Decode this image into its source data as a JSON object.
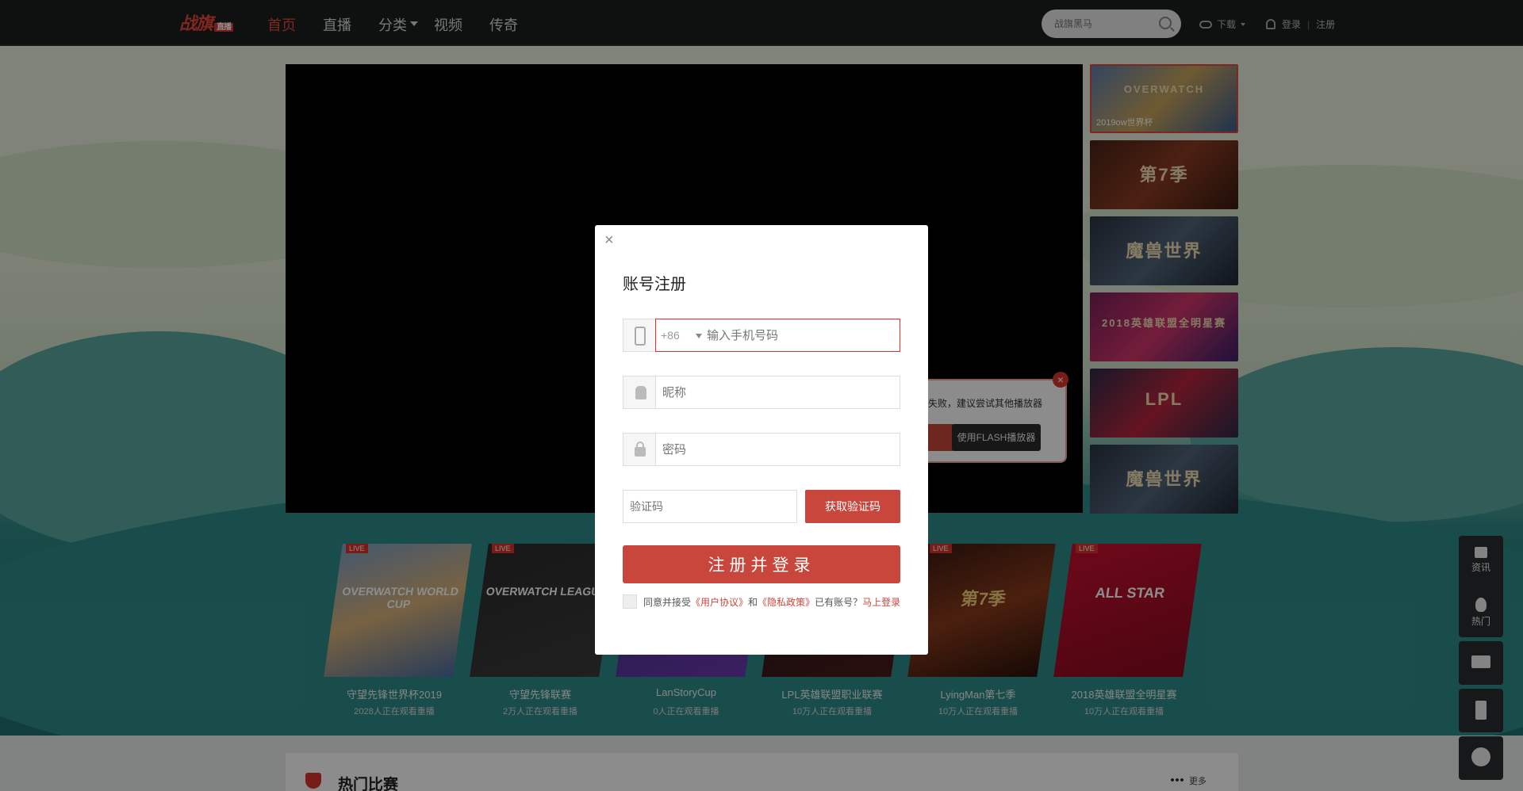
{
  "brand": {
    "logo_text": "战旗",
    "logo_sub": "直播"
  },
  "nav": {
    "items": [
      "首页",
      "直播",
      "分类",
      "视频",
      "传奇"
    ]
  },
  "search": {
    "placeholder": "战旗黑马"
  },
  "header": {
    "download": "下载",
    "login": "登录",
    "sep": "|",
    "register": "注册"
  },
  "flash": {
    "tip": "失败，建议尝试其他播放器",
    "use_flash": "使用FLASH播放器",
    "close": "×"
  },
  "thumbs": [
    {
      "caption": "2019ow世界杯",
      "text": "OVERWATCH"
    },
    {
      "caption": "",
      "text": "第7季"
    },
    {
      "caption": "",
      "text": "魔兽世界"
    },
    {
      "caption": "",
      "text": "2018英雄联盟全明星赛"
    },
    {
      "caption": "",
      "text": "LPL"
    },
    {
      "caption": "",
      "text": "魔兽世界"
    }
  ],
  "lives": [
    {
      "tag": "LIVE",
      "name": "守望先锋世界杯2019",
      "watch": "2028人正在观看重播",
      "emblem": "OVERWATCH WORLD CUP"
    },
    {
      "tag": "LIVE",
      "name": "守望先锋联赛",
      "watch": "2万人正在观看重播",
      "emblem": "OVERWATCH LEAGUE"
    },
    {
      "tag": "",
      "name": "LanStoryCup",
      "watch": "0人正在观看重播",
      "emblem": ""
    },
    {
      "tag": "",
      "name": "LPL英雄联盟职业联赛",
      "watch": "10万人正在观看重播",
      "emblem": ""
    },
    {
      "tag": "LIVE",
      "name": "LyingMan第七季",
      "watch": "10万人正在观看重播",
      "emblem": "第7季"
    },
    {
      "tag": "LIVE",
      "name": "2018英雄联盟全明星赛",
      "watch": "10万人正在观看重播",
      "emblem": "ALL STAR"
    }
  ],
  "side": {
    "news": "资讯",
    "hot": "热门"
  },
  "hot_section": {
    "title": "热门比赛",
    "more": "更多"
  },
  "modal": {
    "close": "×",
    "title": "账号注册",
    "country_code": "+86",
    "phone_placeholder": "输入手机号码",
    "nickname_placeholder": "昵称",
    "password_placeholder": "密码",
    "code_placeholder": "验证码",
    "get_code": "获取验证码",
    "submit": "注册并登录",
    "agree_prefix": "同意并接受",
    "user_agreement": "《用户协议》",
    "and": "和",
    "privacy": "《隐私政策》",
    "has_account": "已有账号？",
    "login_now": "马上登录"
  },
  "colors": {
    "accent": "#c9463c",
    "topbar": "#1d1f20"
  }
}
